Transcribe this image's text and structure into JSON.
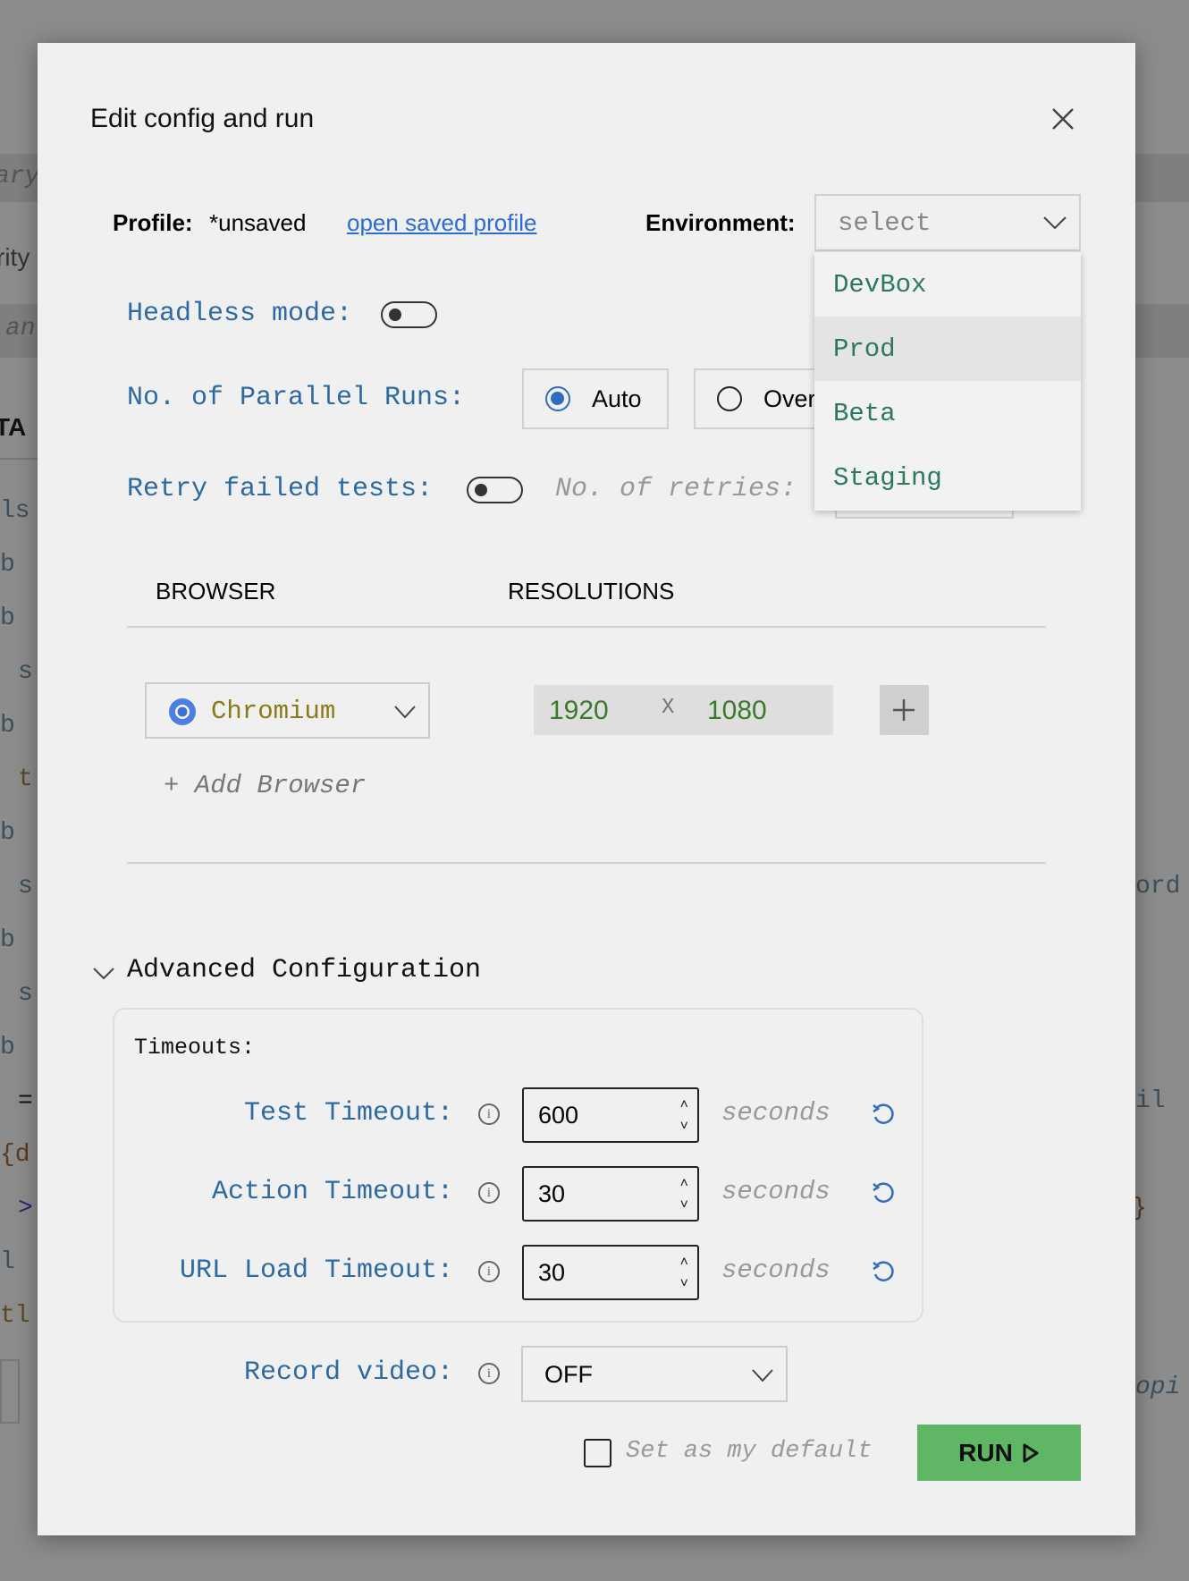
{
  "background": {
    "fragments": [
      "ary",
      "rity",
      "an",
      "TA",
      "ls",
      "b",
      "b",
      "s",
      "b",
      "t",
      "b",
      "s",
      "b",
      "s",
      "b",
      "=",
      "{d",
      ">",
      "l",
      "tl",
      "ord",
      "il",
      "}",
      "opi"
    ]
  },
  "dialog": {
    "title": "Edit config and run",
    "close_icon": "close-icon",
    "profile": {
      "label": "Profile:",
      "value": "*unsaved",
      "link": "open saved profile"
    },
    "environment": {
      "label": "Environment:",
      "placeholder": "select",
      "options": [
        "DevBox",
        "Prod",
        "Beta",
        "Staging"
      ],
      "highlighted": "Prod"
    },
    "headless": {
      "label": "Headless mode:",
      "on": false
    },
    "parallel": {
      "label": "No. of Parallel Runs:",
      "options": [
        "Auto",
        "Over"
      ],
      "selected": "Auto"
    },
    "retry": {
      "label": "Retry failed tests:",
      "on": false,
      "retries_label": "No. of retries:"
    },
    "table": {
      "headers": [
        "BROWSER",
        "RESOLUTIONS"
      ],
      "rows": [
        {
          "browser": "Chromium",
          "width": "1920",
          "sep": "X",
          "height": "1080"
        }
      ],
      "add_browser": "+ Add Browser"
    },
    "advanced": {
      "title": "Advanced Configuration",
      "timeouts_label": "Timeouts:",
      "timeouts": [
        {
          "label": "Test Timeout:",
          "value": "600",
          "unit": "seconds"
        },
        {
          "label": "Action Timeout:",
          "value": "30",
          "unit": "seconds"
        },
        {
          "label": "URL Load Timeout:",
          "value": "30",
          "unit": "seconds"
        }
      ],
      "record_video": {
        "label": "Record video:",
        "value": "OFF"
      }
    },
    "set_default": {
      "label": "Set as my default",
      "checked": false
    },
    "run": {
      "label": "RUN",
      "color": "#5fb665"
    }
  }
}
